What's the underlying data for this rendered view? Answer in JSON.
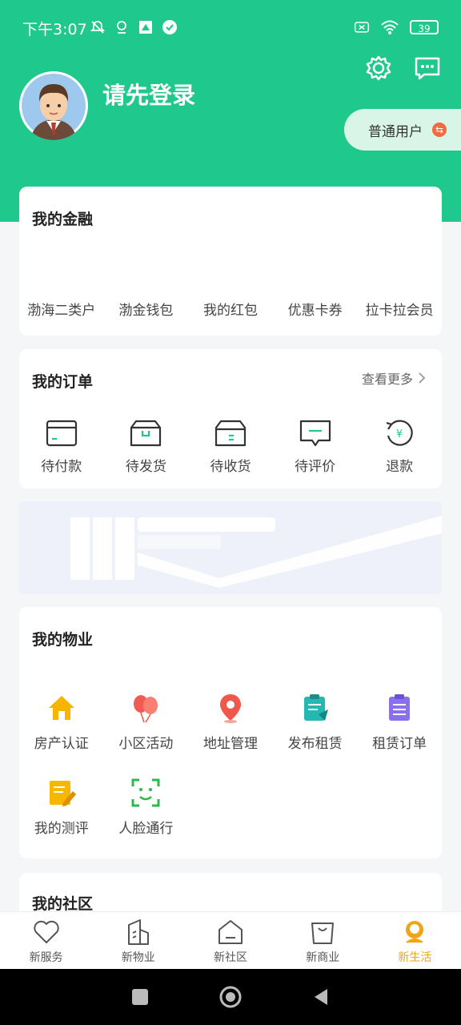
{
  "status": {
    "time": "下午3:07",
    "battery": "39"
  },
  "header": {
    "login_prompt": "请先登录",
    "user_type": "普通用户"
  },
  "finance": {
    "title": "我的金融",
    "items": [
      "渤海二类户",
      "渤金钱包",
      "我的红包",
      "优惠卡券",
      "拉卡拉会员"
    ]
  },
  "orders": {
    "title": "我的订单",
    "view_more": "查看更多",
    "items": [
      "待付款",
      "待发货",
      "待收货",
      "待评价",
      "退款"
    ]
  },
  "property": {
    "title": "我的物业",
    "items": [
      "房产认证",
      "小区活动",
      "地址管理",
      "发布租赁",
      "租赁订单",
      "我的测评",
      "人脸通行"
    ]
  },
  "community": {
    "title": "我的社区"
  },
  "tabs": {
    "items": [
      "新服务",
      "新物业",
      "新社区",
      "新商业",
      "新生活"
    ],
    "active_index": 4
  },
  "colors": {
    "brand": "#1fc88c",
    "active_tab": "#f0a418"
  }
}
